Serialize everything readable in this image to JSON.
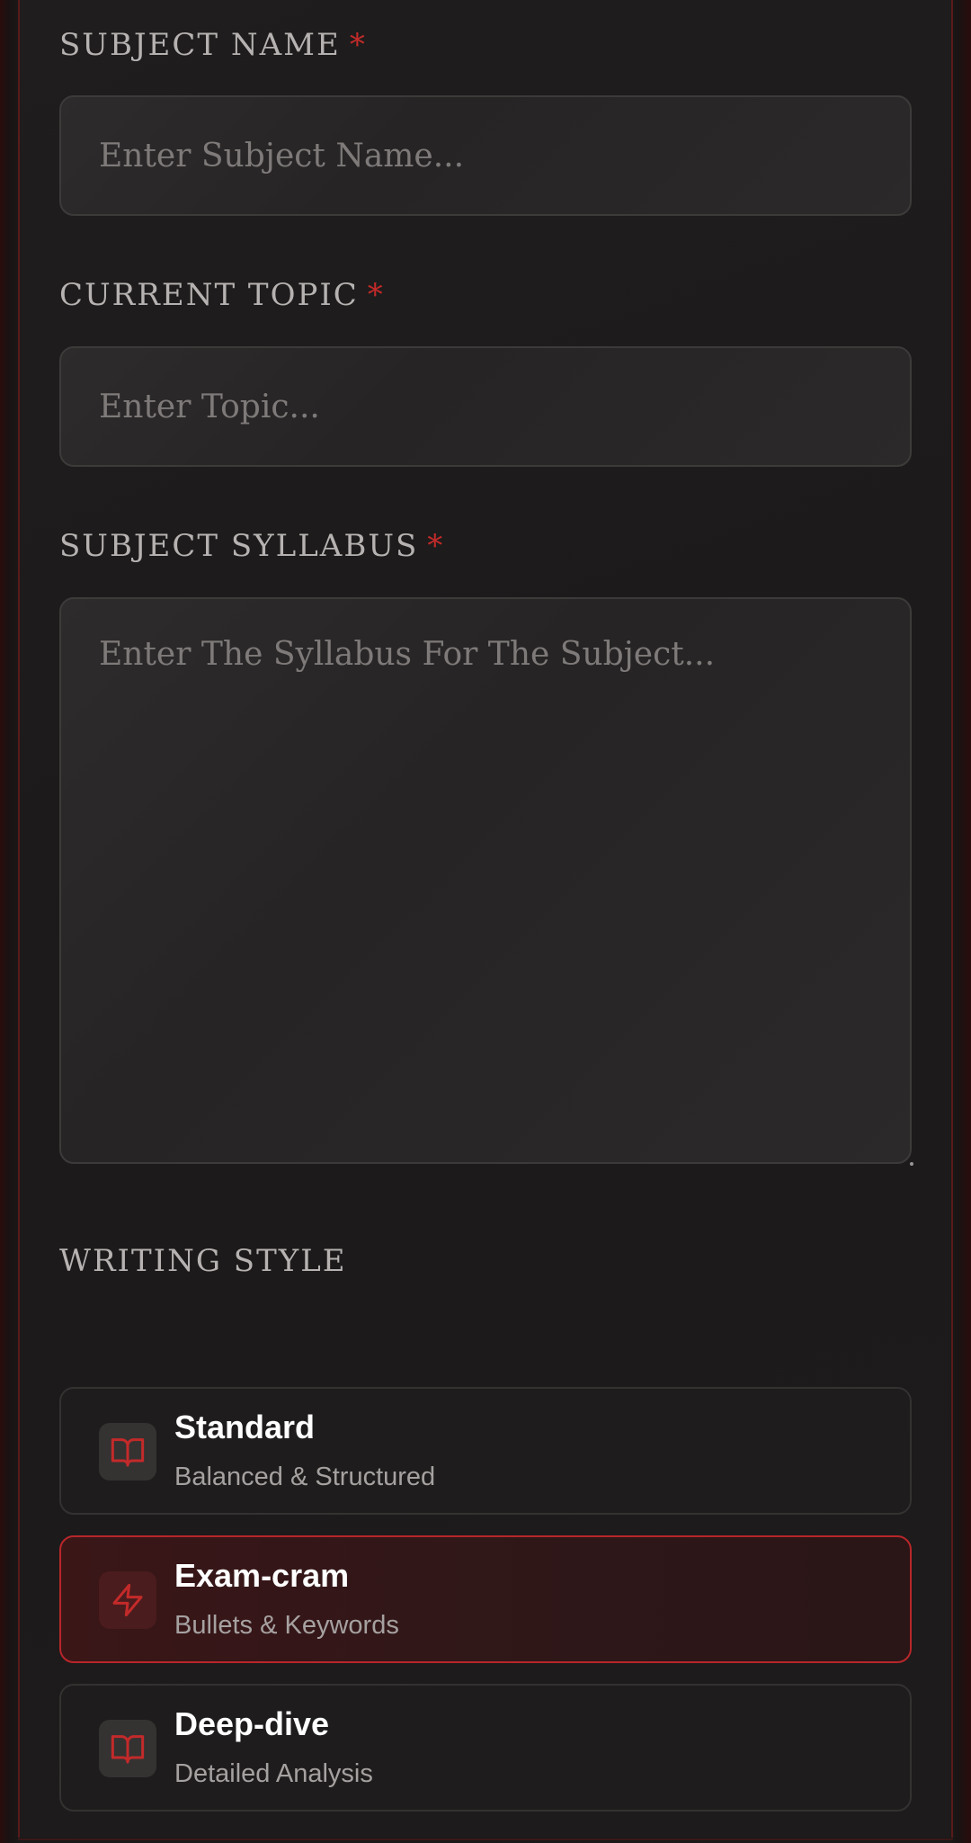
{
  "form": {
    "subject_name": {
      "label": "SUBJECT NAME",
      "required_mark": "*",
      "placeholder": "Enter Subject Name...",
      "value": ""
    },
    "current_topic": {
      "label": "CURRENT TOPIC",
      "required_mark": "*",
      "placeholder": "Enter Topic...",
      "value": ""
    },
    "subject_syllabus": {
      "label": "SUBJECT SYLLABUS",
      "required_mark": "*",
      "placeholder": "Enter The Syllabus For The Subject...",
      "value": ""
    }
  },
  "writing_style": {
    "label": "WRITING STYLE",
    "selected": "Exam-cram",
    "options": [
      {
        "title": "Standard",
        "subtitle": "Balanced & Structured",
        "icon": "book-icon"
      },
      {
        "title": "Exam-cram",
        "subtitle": "Bullets & Keywords",
        "icon": "lightning-icon"
      },
      {
        "title": "Deep-dive",
        "subtitle": "Detailed Analysis",
        "icon": "book-icon"
      }
    ]
  },
  "colors": {
    "accent": "#c32a2a",
    "background": "#1c1a1a",
    "field": "#2a2828",
    "selected_border": "#b8262a"
  }
}
